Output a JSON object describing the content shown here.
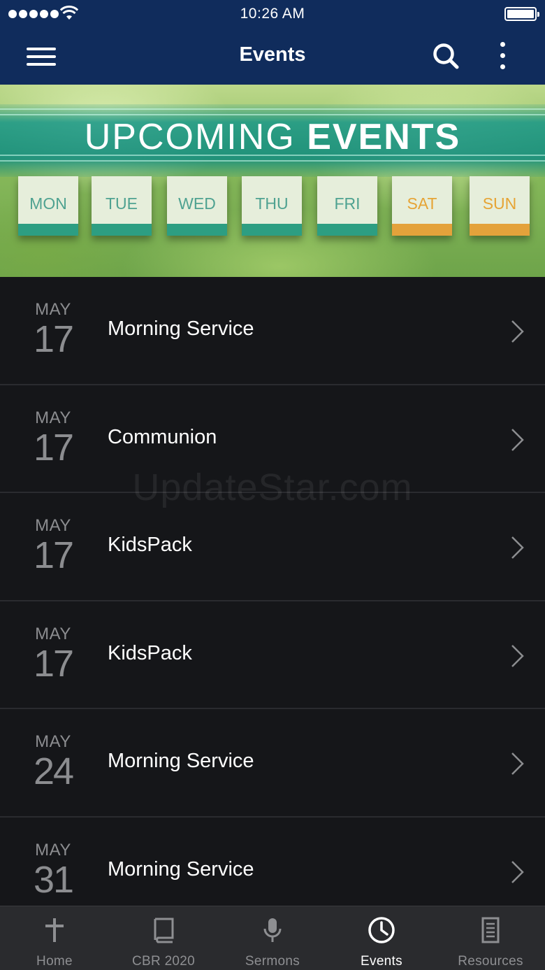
{
  "status_bar": {
    "time": "10:26 AM"
  },
  "nav": {
    "title": "Events"
  },
  "banner": {
    "title_part1": "UPCOMING",
    "title_part2": "EVENTS",
    "days": [
      "MON",
      "TUE",
      "WED",
      "THU",
      "FRI",
      "SAT",
      "SUN"
    ]
  },
  "events": [
    {
      "month": "MAY",
      "day": "17",
      "title": "Morning Service"
    },
    {
      "month": "MAY",
      "day": "17",
      "title": "Communion"
    },
    {
      "month": "MAY",
      "day": "17",
      "title": "KidsPack"
    },
    {
      "month": "MAY",
      "day": "17",
      "title": "KidsPack"
    },
    {
      "month": "MAY",
      "day": "24",
      "title": "Morning Service"
    },
    {
      "month": "MAY",
      "day": "31",
      "title": "Morning Service"
    }
  ],
  "watermark": "UpdateStar.com",
  "tabs": [
    {
      "label": "Home",
      "icon": "cross-icon",
      "active": false
    },
    {
      "label": "CBR 2020",
      "icon": "book-icon",
      "active": false
    },
    {
      "label": "Sermons",
      "icon": "microphone-icon",
      "active": false
    },
    {
      "label": "Events",
      "icon": "clock-icon",
      "active": true
    },
    {
      "label": "Resources",
      "icon": "document-icon",
      "active": false
    }
  ],
  "colors": {
    "nav_background": "#102c5c",
    "list_background": "#151619",
    "tabbar_background": "#2a2b2e",
    "weekday_accent": "#2d9e82",
    "weekend_accent": "#e4a23b"
  }
}
